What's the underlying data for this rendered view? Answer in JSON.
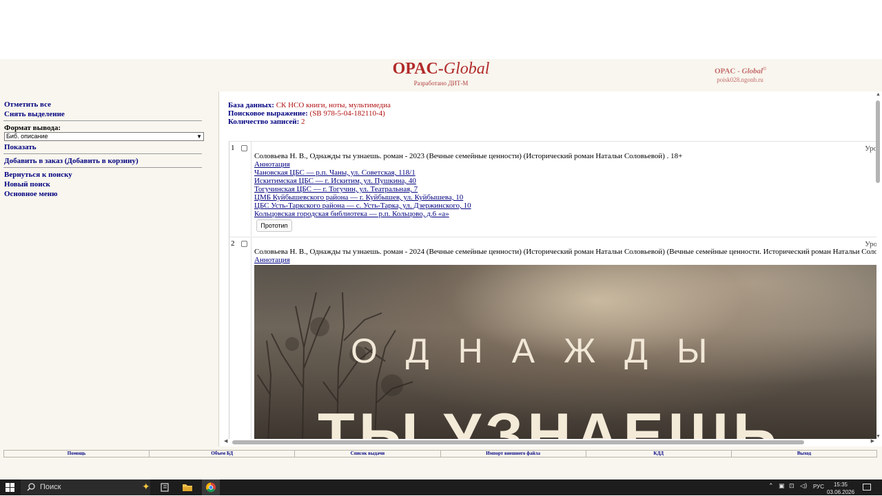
{
  "header": {
    "logo_main": "OPAC-",
    "logo_italic": "Global",
    "logo_sub": "Разработано ДИТ-М",
    "brand_right_main": "OPAC - ",
    "brand_right_italic": "Global",
    "brand_right_mark": "©",
    "brand_right_host": "poisk028.ngonb.ru"
  },
  "left_menu": {
    "mark_all": "Отметить все",
    "unmark": "Снять выделение",
    "format_label": "Формат вывода:",
    "format_selected": "Биб. описание",
    "show": "Показать",
    "add_order": "Добавить в заказ (Добавить в корзину)",
    "back_to_search": "Вернуться к поиску",
    "new_search": "Новый поиск",
    "main_menu": "Основное меню"
  },
  "info": {
    "db_label": "База данных:",
    "db_value": "СК НСО книги, ноты, мультимедиа",
    "query_label": "Поисковое выражение:",
    "query_value": "(SB 978-5-04-182110-4)",
    "count_label": "Количество записей:",
    "count_value": "2"
  },
  "records": [
    {
      "num": "1",
      "uro": "Уро",
      "title": "Соловьева Н. В., Однажды ты узнаешь. роман - 2023 (Вечные семейные ценности) (Исторический роман Натальи Соловьевой) . 18+",
      "annotation": "Аннотация",
      "holdings": [
        "Чановская ЦБС — р.п. Чаны, ул. Советская, 118/1",
        "Искитимская ЦБС — г. Искитим, ул. Пушкина, 40",
        "Тогучинская ЦБС — г. Тогучин, ул. Театральная, 7",
        "ЦМБ Куйбышевского района — г. Куйбышев, ул. Куйбышева, 10",
        "ЦБС Усть-Таркского района — с. Усть-Тарка, ул. Дзержинского, 10",
        "Кольцовская городская библиотека — р.п. Кольцово, д.6 «а»"
      ],
      "prototype_button": "Прототип"
    },
    {
      "num": "2",
      "uro": "Уро",
      "title": "Соловьева Н. В., Однажды ты узнаешь. роман - 2024 (Вечные семейные ценности) (Исторический роман Натальи Соловьевой) (Вечные семейные ценности. Исторический роман Натальи Соловьевой",
      "annotation": "Аннотация",
      "cover_line1": "ОДНАЖДЫ",
      "cover_line2": "ТЫ УЗНАЕШЬ"
    }
  ],
  "bottom_nav": [
    "Помощь",
    "Объем БД",
    "Список выдачи",
    "Импорт внешнего файла",
    "КДД",
    "Выход"
  ],
  "taskbar": {
    "search_placeholder": "Поиск",
    "lang": "РУС",
    "time": "15:35",
    "date": "03.06.2026"
  },
  "icons": {
    "start": "windows-logo-icon",
    "search": "magnifier-icon",
    "copilot": "sparkle-icon",
    "task_view": "task-view-icon",
    "explorer": "folder-icon",
    "browser": "chrome-icon"
  },
  "colors": {
    "panel_bg": "#f8f6ee",
    "link": "#000080",
    "value_red": "#b01010",
    "logo_red": "#b22a2a",
    "taskbar": "#1d1d1d"
  }
}
